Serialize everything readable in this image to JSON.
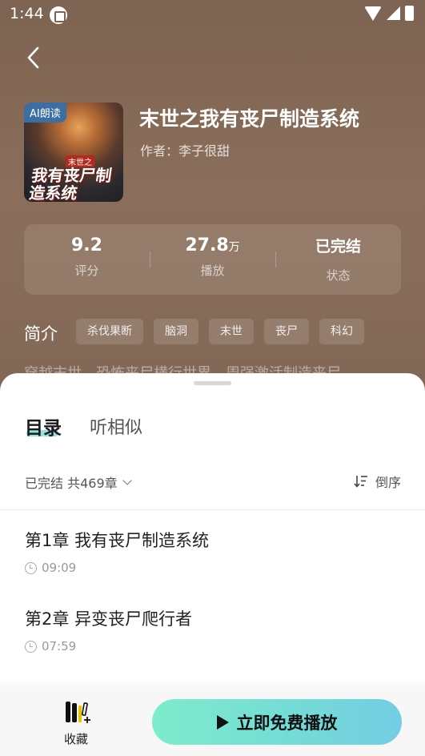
{
  "status_bar": {
    "time": "1:44"
  },
  "book": {
    "badge": "AI朗读",
    "cover_subtitle": "末世之",
    "cover_title": "我有丧尸制造系统",
    "title": "末世之我有丧尸制造系统",
    "author": "作者：李子很甜"
  },
  "stats": [
    {
      "value": "9.2",
      "unit": "",
      "label": "评分"
    },
    {
      "value": "27.8",
      "unit": "万",
      "label": "播放"
    },
    {
      "value": "已完结",
      "unit": "",
      "label": "状态"
    }
  ],
  "synopsis": {
    "heading": "简介",
    "tags": [
      "杀伐果断",
      "脑洞",
      "末世",
      "丧尸",
      "科幻"
    ],
    "text": "穿越末世，恐怖丧尸横行世界，周强激活制造丧尸"
  },
  "sheet": {
    "tabs": [
      "目录",
      "听相似"
    ],
    "chapter_info": "已完结 共469章",
    "sort_label": "倒序",
    "chapters": [
      {
        "title": "第1章  我有丧尸制造系统",
        "duration": "09:09"
      },
      {
        "title": "第2章  异变丧尸爬行者",
        "duration": "07:59"
      }
    ]
  },
  "bottom_bar": {
    "favorite_label": "收藏",
    "play_label": "立即免费播放"
  },
  "colors": {
    "accent_gradient_start": "#7deccb",
    "accent_gradient_end": "#73cde4",
    "header_background": "#8a6e5b"
  },
  "icons": [
    "back-icon",
    "wifi-icon",
    "signal-icon",
    "battery-icon",
    "chevron-down-icon",
    "sort-icon",
    "clock-icon",
    "bookshelf-icon",
    "play-icon"
  ]
}
